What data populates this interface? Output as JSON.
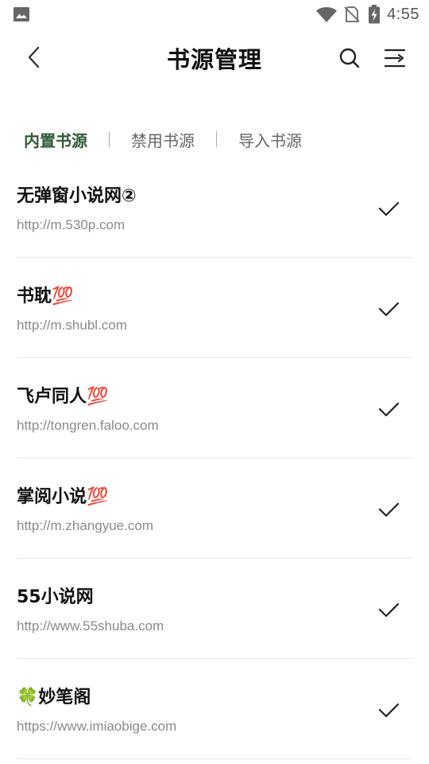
{
  "status_bar": {
    "time": "4:55",
    "icons": [
      "image-notification-icon",
      "wifi-icon",
      "no-sim-icon",
      "battery-charging-icon"
    ]
  },
  "toolbar": {
    "title": "书源管理",
    "icons": [
      "back-icon",
      "search-icon",
      "menu-icon"
    ]
  },
  "tabs": [
    {
      "label": "内置书源",
      "active": true
    },
    {
      "label": "禁用书源",
      "active": false
    },
    {
      "label": "导入书源",
      "active": false
    }
  ],
  "sources": [
    {
      "name": "无弹窗小说网②",
      "url": "http://m.530p.com",
      "enabled": true
    },
    {
      "name": "书耽💯",
      "url": "http://m.shubl.com",
      "enabled": true
    },
    {
      "name": "飞卢同人💯",
      "url": "http://tongren.faloo.com",
      "enabled": true
    },
    {
      "name": "掌阅小说💯",
      "url": "http://m.zhangyue.com",
      "enabled": true
    },
    {
      "name": "55小说网",
      "url": "http://www.55shuba.com",
      "enabled": true
    },
    {
      "name": "🍀妙笔阁",
      "url": "https://www.imiaobige.com",
      "enabled": true
    }
  ]
}
